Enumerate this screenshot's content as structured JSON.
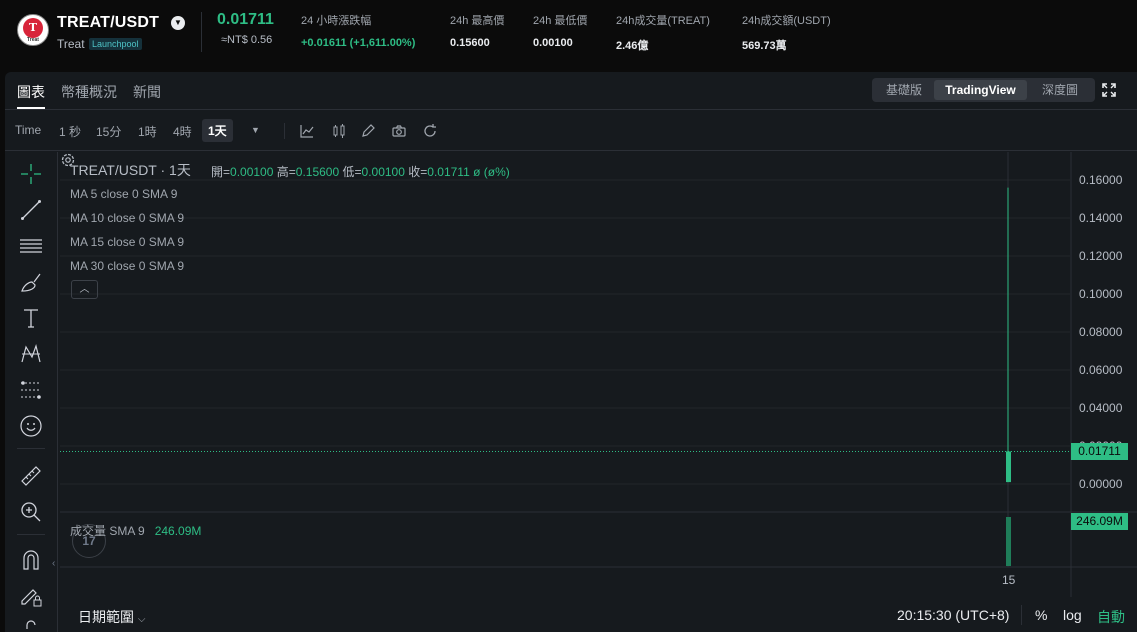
{
  "header": {
    "logo_word": "Treat",
    "pair": "TREAT/USDT",
    "name": "Treat",
    "badge": "Launchpool",
    "last_price": "0.01711",
    "fiat_price": "≈NT$ 0.56",
    "stats": [
      {
        "label": "24 小時漲跌幅",
        "value": "+0.01611 (+1,611.00%)",
        "color": "green"
      },
      {
        "label": "24h 最高價",
        "value": "0.15600"
      },
      {
        "label": "24h 最低價",
        "value": "0.00100"
      },
      {
        "label": "24h成交量(TREAT)",
        "value": "2.46億"
      },
      {
        "label": "24h成交額(USDT)",
        "value": "569.73萬"
      }
    ]
  },
  "tabs": {
    "chart": "圖表",
    "info": "幣種概況",
    "news": "新聞"
  },
  "views": {
    "basic": "基礎版",
    "tradingview": "TradingView",
    "depth": "深度圖"
  },
  "toolbar": {
    "time_label": "Time",
    "intervals": [
      "1 秒",
      "15分",
      "1時",
      "4時",
      "1天"
    ],
    "active_interval": "1天"
  },
  "chart_legend": {
    "title": "TREAT/USDT · 1天",
    "open_label": "開=",
    "open": "0.00100",
    "high_label": "高=",
    "high": "0.15600",
    "low_label": "低=",
    "low": "0.00100",
    "close_label": "收=",
    "close": "0.01711",
    "change": "ø (ø%)",
    "ma": [
      "MA 5 close 0 SMA 9",
      "MA 10 close 0 SMA 9",
      "MA 15 close 0 SMA 9",
      "MA 30 close 0 SMA 9"
    ],
    "volume_label": "成交量 SMA 9",
    "volume_value": "246.09M",
    "last_price_tag": "0.01711",
    "volume_tag": "246.09M"
  },
  "chart_data": {
    "type": "candlestick",
    "x_ticks": [
      "15"
    ],
    "y_ticks": [
      "0.16000",
      "0.14000",
      "0.12000",
      "0.10000",
      "0.08000",
      "0.06000",
      "0.04000",
      "0.02000",
      "0.00000"
    ],
    "ylim": [
      0,
      0.16
    ],
    "candles": [
      {
        "x": "15",
        "open": 0.001,
        "high": 0.156,
        "low": 0.001,
        "close": 0.01711,
        "volume": 246090000
      }
    ],
    "colors": {
      "up": "#2ebd85",
      "grid": "#22262b"
    }
  },
  "footer": {
    "range": "日期範圍",
    "time": "20:15:30 (UTC+8)",
    "percent": "%",
    "log": "log",
    "auto": "自動"
  }
}
